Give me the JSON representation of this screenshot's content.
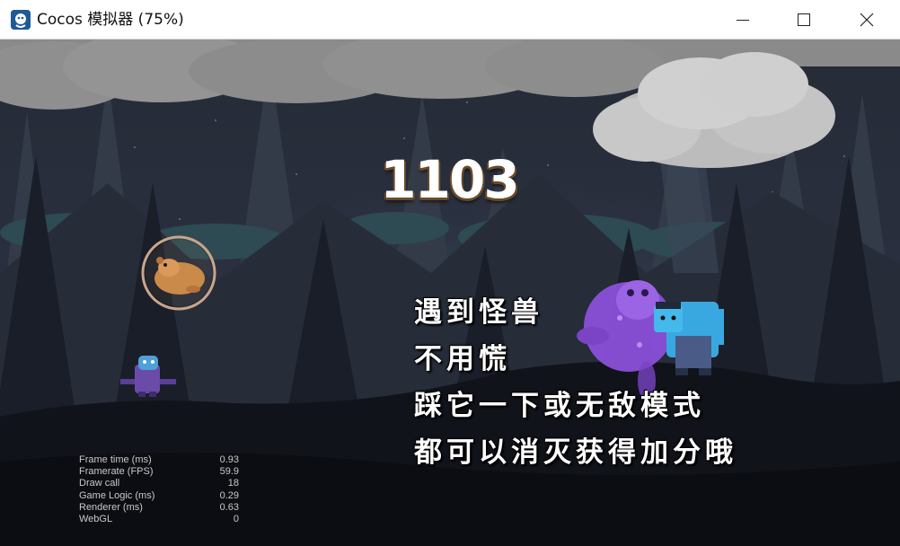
{
  "window": {
    "title": "Cocos 模拟器 (75%)"
  },
  "icons": {
    "app": "cocos-logo-icon",
    "minimize": "minimize-icon",
    "maximize": "maximize-icon",
    "close": "close-icon"
  },
  "game": {
    "score": "1103",
    "message": [
      "遇到怪兽",
      "不用慌",
      "踩它一下或无敌模式",
      "都可以消灭获得加分哦"
    ]
  },
  "stats": [
    {
      "label": "Frame time (ms)",
      "value": "0.93"
    },
    {
      "label": "Framerate (FPS)",
      "value": "59.9"
    },
    {
      "label": "Draw call",
      "value": "18"
    },
    {
      "label": "Game Logic (ms)",
      "value": "0.29"
    },
    {
      "label": "Renderer (ms)",
      "value": "0.63"
    },
    {
      "label": "WebGL",
      "value": "0"
    }
  ],
  "colors": {
    "sky": "#1f2430",
    "cloud": "#8a8a8a",
    "hamster": "#c98a4a",
    "monster_purple": "#8a50d8",
    "player_blue": "#3aa8e0"
  }
}
